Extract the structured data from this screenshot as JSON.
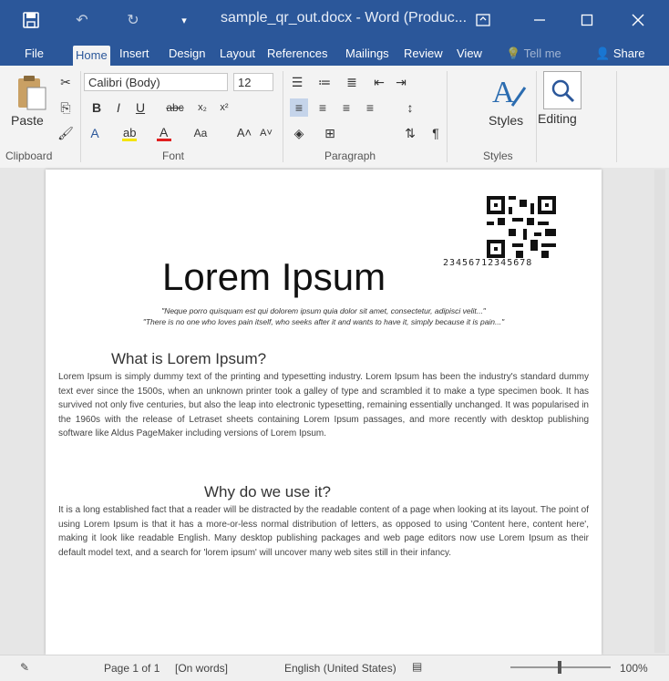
{
  "titlebar": {
    "title": "sample_qr_out.docx - Word (Produc...",
    "dropdown_glyph": "▾"
  },
  "tabs": [
    {
      "label": "File",
      "active": false
    },
    {
      "label": "Home",
      "active": true
    },
    {
      "label": "Insert",
      "active": false
    },
    {
      "label": "Design",
      "active": false
    },
    {
      "label": "Layout",
      "active": false
    },
    {
      "label": "References",
      "active": false
    },
    {
      "label": "Mailings",
      "active": false
    },
    {
      "label": "Review",
      "active": false
    },
    {
      "label": "View",
      "active": false
    }
  ],
  "tell_me": "Tell me",
  "share": "Share",
  "ribbon": {
    "paste": "Paste",
    "clipboard": "Clipboard",
    "font_name": "Calibri (Body)",
    "font_size": "12",
    "font_group": "Font",
    "paragraph_group": "Paragraph",
    "styles": "Styles",
    "styles_group": "Styles",
    "editing": "Editing"
  },
  "document": {
    "qr_caption": "23456712345678",
    "title": "Lorem Ipsum",
    "quote1": "\"Neque porro quisquam est qui dolorem ipsum quia dolor sit amet, consectetur, adipisci velit...\"",
    "quote2": "\"There is no one who loves pain itself, who seeks after it and wants to have it, simply because it is pain...\"",
    "heading1": "What is Lorem Ipsum?",
    "para1": "Lorem Ipsum is simply dummy text of the printing and typesetting industry. Lorem Ipsum has been the industry's standard dummy text ever since the 1500s, when an unknown printer took a galley of type and scrambled it to make a type specimen book. It has survived not only five centuries, but also the leap into electronic typesetting, remaining essentially unchanged. It was popularised in the 1960s with the release of Letraset sheets containing Lorem Ipsum passages, and more recently with desktop publishing software like Aldus PageMaker including versions of Lorem Ipsum.",
    "heading2": "Why do we use it?",
    "para2": "It is a long established fact that a reader will be distracted by the readable content of a page when looking at its layout. The point of using Lorem Ipsum is that it has a more-or-less normal distribution of letters, as opposed to using 'Content here, content here', making it look like readable English. Many desktop publishing packages and web page editors now use Lorem Ipsum as their default model text, and a search for 'lorem ipsum' will uncover many web sites still in their infancy."
  },
  "status": {
    "page": "Page 1 of 1",
    "words": "[On words]",
    "language": "English (United States)",
    "zoom": "100%"
  },
  "colors": {
    "accent": "#2b579a",
    "ribbon": "#f3f3f3"
  }
}
